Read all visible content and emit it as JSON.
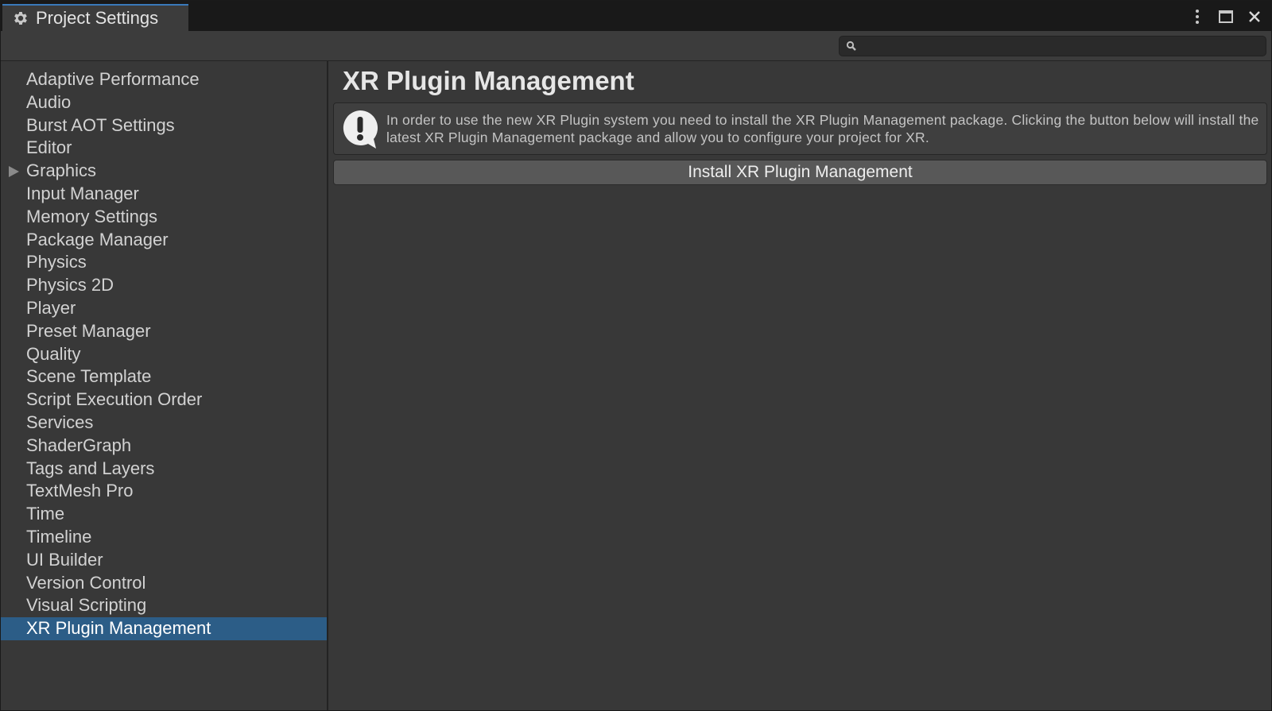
{
  "window": {
    "tab_title": "Project Settings",
    "tab_icon": "gear-icon",
    "controls": [
      "more-options-icon",
      "maximize-icon",
      "close-icon"
    ]
  },
  "search": {
    "value": "",
    "icon": "search-icon"
  },
  "sidebar": {
    "items": [
      {
        "label": "Adaptive Performance"
      },
      {
        "label": "Audio"
      },
      {
        "label": "Burst AOT Settings"
      },
      {
        "label": "Editor"
      },
      {
        "label": "Graphics",
        "expandable": true
      },
      {
        "label": "Input Manager"
      },
      {
        "label": "Memory Settings"
      },
      {
        "label": "Package Manager"
      },
      {
        "label": "Physics"
      },
      {
        "label": "Physics 2D"
      },
      {
        "label": "Player"
      },
      {
        "label": "Preset Manager"
      },
      {
        "label": "Quality"
      },
      {
        "label": "Scene Template"
      },
      {
        "label": "Script Execution Order"
      },
      {
        "label": "Services"
      },
      {
        "label": "ShaderGraph"
      },
      {
        "label": "Tags and Layers"
      },
      {
        "label": "TextMesh Pro"
      },
      {
        "label": "Time"
      },
      {
        "label": "Timeline"
      },
      {
        "label": "UI Builder"
      },
      {
        "label": "Version Control"
      },
      {
        "label": "Visual Scripting"
      },
      {
        "label": "XR Plugin Management",
        "selected": true
      }
    ]
  },
  "main": {
    "title": "XR Plugin Management",
    "help": {
      "icon": "warning-icon",
      "text": "In order to use the new XR Plugin system you need to install the XR Plugin Management package. Clicking the button below will install the latest XR Plugin Management package and allow you to configure your project for XR."
    },
    "install_button_label": "Install XR Plugin Management"
  },
  "colors": {
    "accent_tab": "#3a79bb",
    "selection": "#2c5d87",
    "panel": "#383838"
  }
}
